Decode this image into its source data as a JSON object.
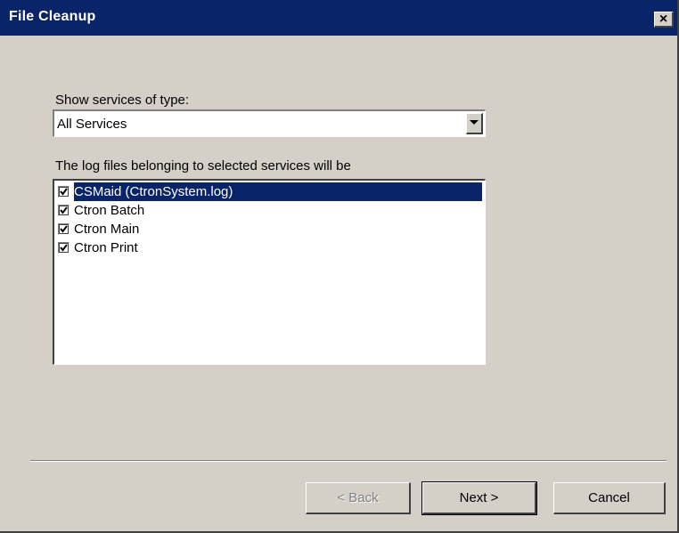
{
  "window": {
    "title": "File Cleanup",
    "close_glyph": "×"
  },
  "service_type": {
    "label": "Show services of type:",
    "selected": "All Services"
  },
  "service_list": {
    "label": "The log files belonging to selected services will be",
    "items": [
      {
        "label": "CSMaid  (CtronSystem.log)",
        "checked": true,
        "selected": true
      },
      {
        "label": "Ctron Batch",
        "checked": true,
        "selected": false
      },
      {
        "label": "Ctron Main",
        "checked": true,
        "selected": false
      },
      {
        "label": "Ctron Print",
        "checked": true,
        "selected": false
      }
    ]
  },
  "buttons": {
    "back_label": "< Back",
    "next_label": "Next >",
    "cancel_label": "Cancel"
  },
  "colors": {
    "titlebar": "#0a246a",
    "face": "#d4d0c8",
    "selection": "#0a246a"
  }
}
